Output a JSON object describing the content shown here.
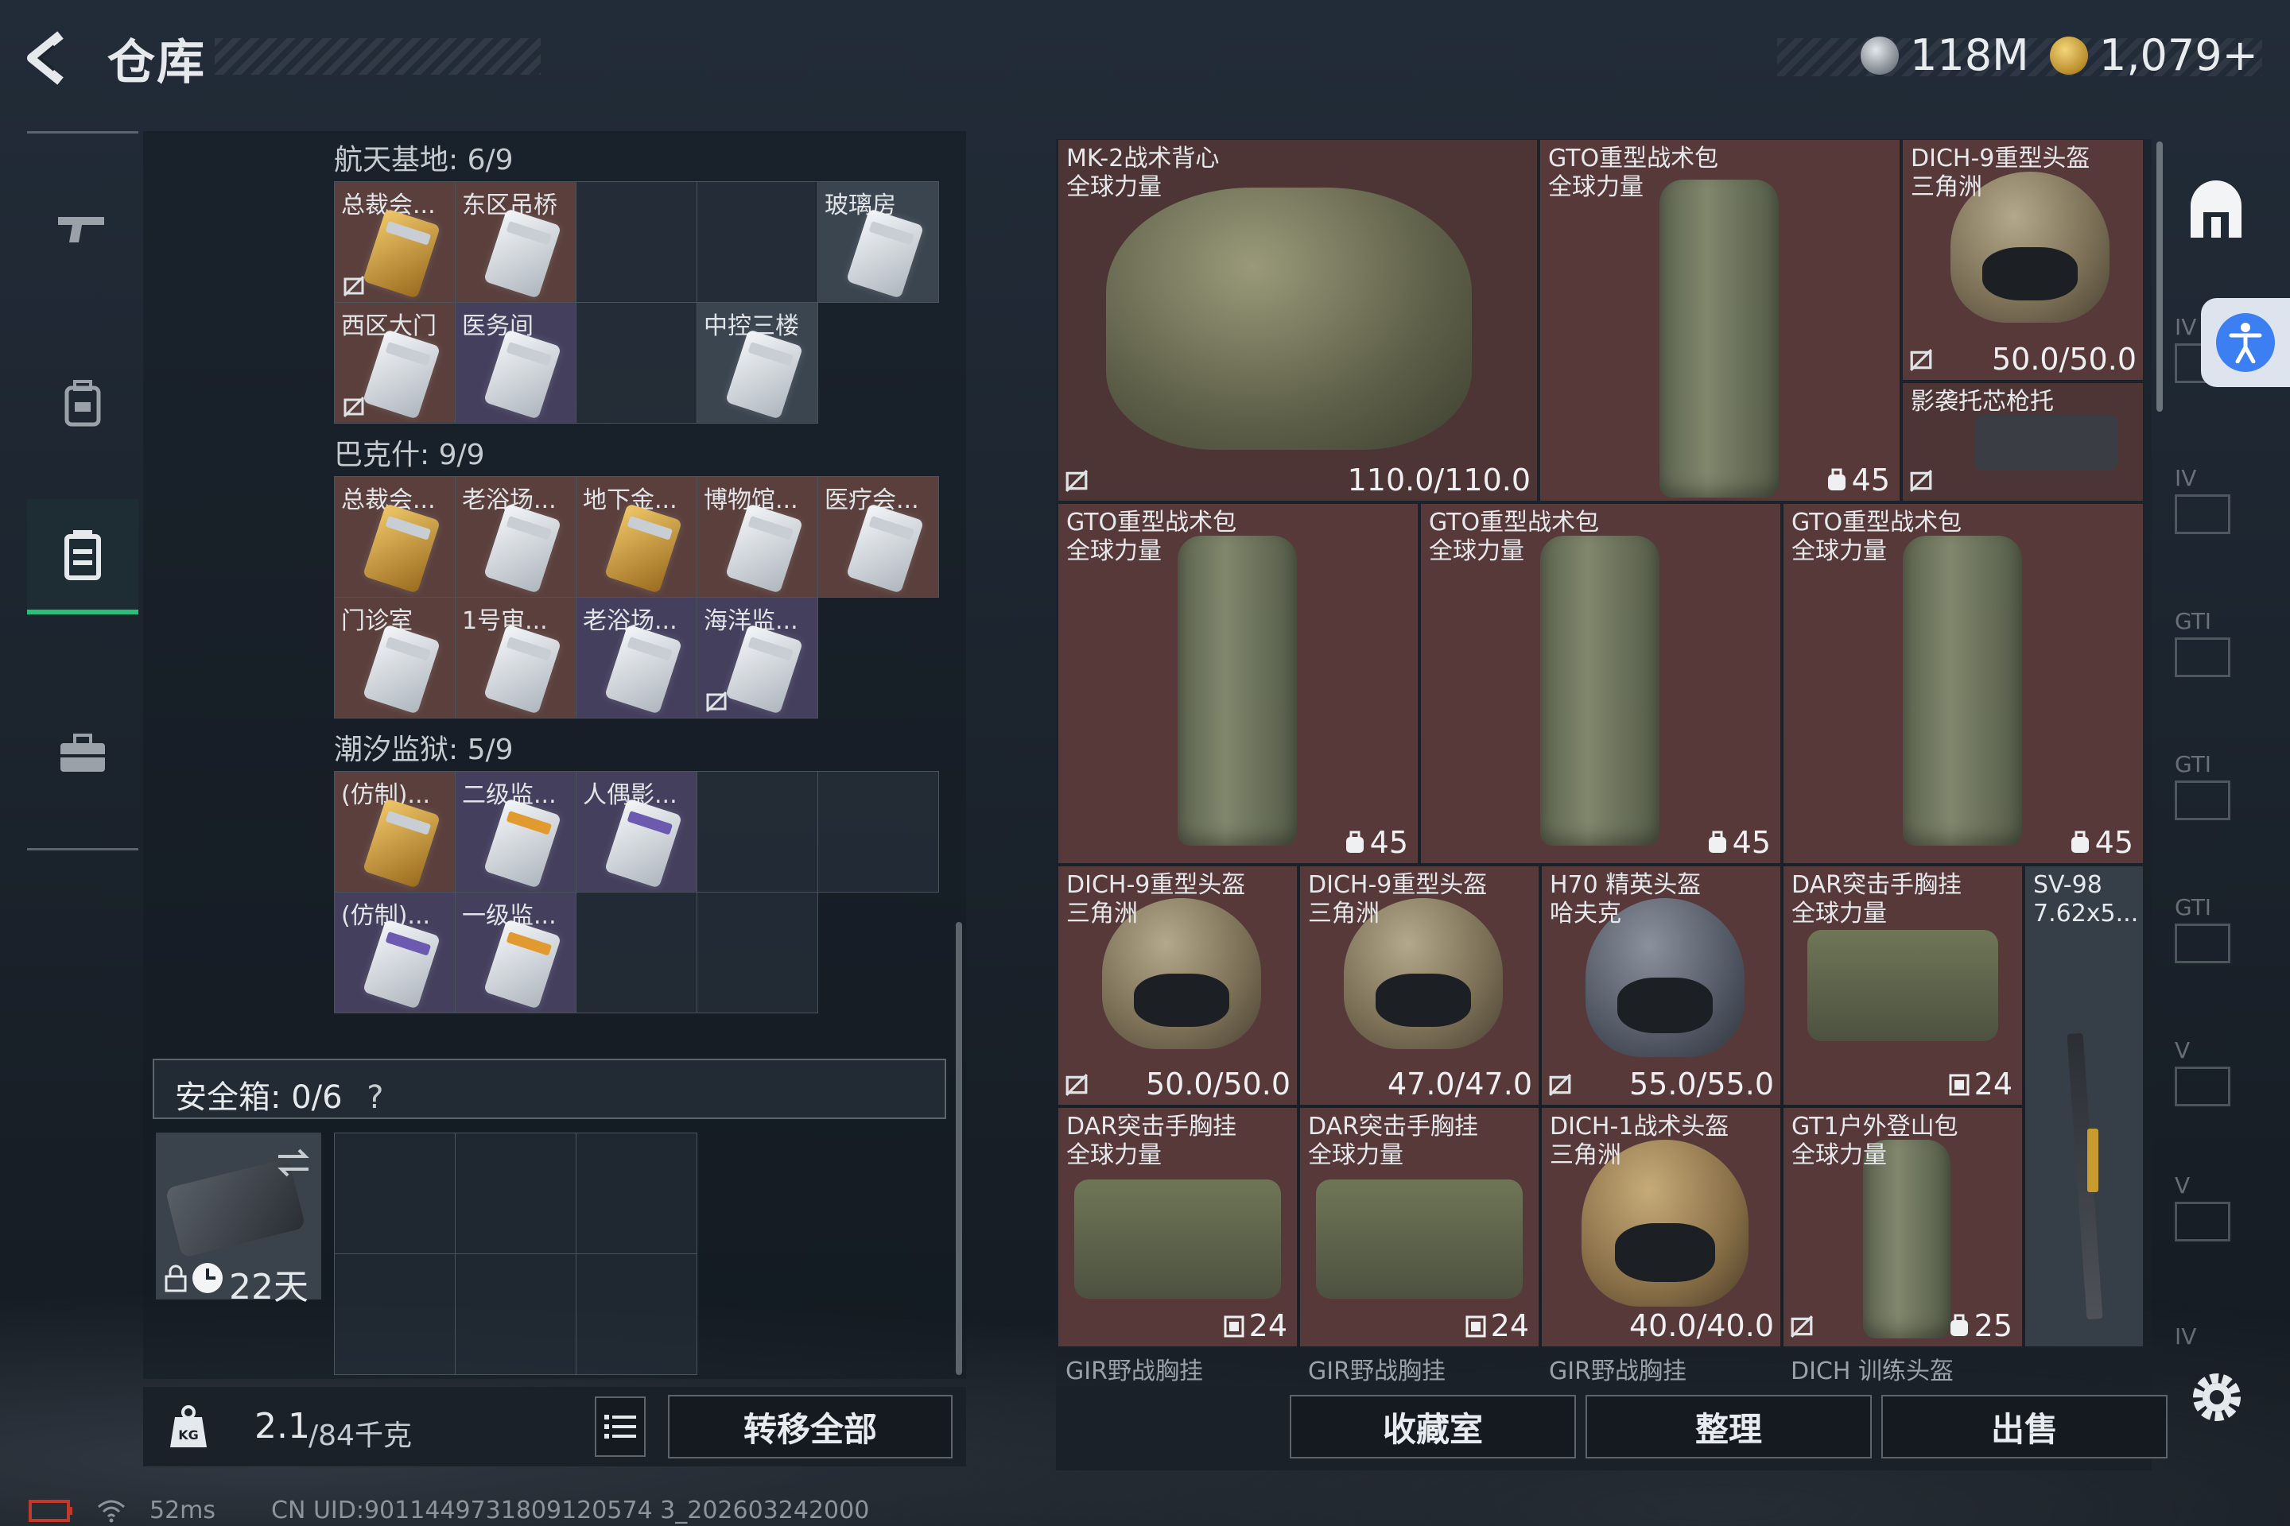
{
  "header": {
    "title": "仓库",
    "currency_1": "118M",
    "currency_2": "1,079+"
  },
  "left_rail": {
    "items": [
      "weapon-icon",
      "backpack-icon",
      "warehouse-icon",
      "briefcase-icon"
    ],
    "active_index": 2
  },
  "sections": [
    {
      "title": "航天基地: 6/9",
      "cells": [
        "总裁会...",
        "东区吊桥",
        "",
        "",
        "玻璃房",
        "西区大门",
        "医务间",
        "",
        "中控三楼",
        ""
      ]
    },
    {
      "title": "巴克什: 9/9",
      "cells": [
        "总裁会...",
        "老浴场...",
        "地下金...",
        "博物馆...",
        "医疗会...",
        "门诊室",
        "1号审...",
        "老浴场...",
        "海洋监..."
      ]
    },
    {
      "title": "潮汐监狱: 5/9",
      "cells": [
        "(仿制)...",
        "二级监...",
        "人偶影...",
        "",
        "",
        "(仿制)...",
        "一级监...",
        "",
        "",
        ""
      ]
    }
  ],
  "safe_box": {
    "label": "安全箱: 0/6",
    "help": "?",
    "timer": "22天"
  },
  "weight": {
    "current": "2.1",
    "total": "/84千克",
    "icon_label": "KG"
  },
  "buttons": {
    "transfer_all": "转移全部",
    "collection": "收藏室",
    "sort": "整理",
    "sell": "出售"
  },
  "inventory": [
    {
      "name": "MK-2战术背心\n全球力量",
      "value": "110.0/110.0"
    },
    {
      "name": "GTO重型战术包\n全球力量",
      "count": "45"
    },
    {
      "name": "DICH-9重型头盔\n三角洲",
      "value": "50.0/50.0"
    },
    {
      "name": "影袭托芯枪托",
      "value": ""
    },
    {
      "name": "GTO重型战术包\n全球力量",
      "count": "45"
    },
    {
      "name": "GTO重型战术包\n全球力量",
      "count": "45"
    },
    {
      "name": "GTO重型战术包\n全球力量",
      "count": "45"
    },
    {
      "name": "DICH-9重型头盔\n三角洲",
      "value": "50.0/50.0"
    },
    {
      "name": "DICH-9重型头盔\n三角洲",
      "value": "47.0/47.0"
    },
    {
      "name": "H70 精英头盔\n哈夫克",
      "value": "55.0/55.0"
    },
    {
      "name": "DAR突击手胸挂\n全球力量",
      "count": "24"
    },
    {
      "name": "SV-98\n7.62x5...",
      "value": ""
    },
    {
      "name": "DAR突击手胸挂\n全球力量",
      "count": "24"
    },
    {
      "name": "DAR突击手胸挂\n全球力量",
      "count": "24"
    },
    {
      "name": "DICH-1战术头盔\n三角洲",
      "value": "40.0/40.0"
    },
    {
      "name": "GT1户外登山包\n全球力量",
      "count": "25"
    }
  ],
  "partial_row": [
    "GIR野战胸挂",
    "GIR野战胸挂",
    "GIR野战胸挂",
    "DICH 训练头盔"
  ],
  "right_rail": {
    "labels": [
      "",
      "IV",
      "IV",
      "GTI",
      "GTI",
      "GTI",
      "V",
      "V",
      "IV"
    ]
  },
  "status_bar": {
    "ping": "52ms",
    "uid": "CN UID:9011449731809120574 3_202603242000"
  },
  "colors": {
    "accent_green": "#27c07a",
    "item_red": "#57393a",
    "item_purple": "#443f5d",
    "accessibility_blue": "#3c7ff2"
  }
}
